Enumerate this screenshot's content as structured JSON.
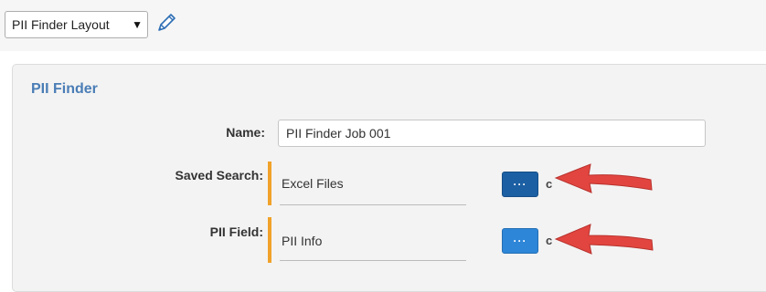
{
  "toolbar": {
    "layout_select": "PII Finder Layout",
    "caret_icon": "▼",
    "edit_icon": "pencil-icon"
  },
  "card": {
    "title": "PII Finder",
    "fields": {
      "name": {
        "label": "Name:",
        "value": "PII Finder Job 001"
      },
      "saved_search": {
        "label": "Saved Search:",
        "value": "Excel Files",
        "button": "···"
      },
      "pii_field": {
        "label": "PII Field:",
        "value": "PII Info",
        "button": "···"
      }
    }
  },
  "colors": {
    "title": "#4a7db6",
    "required_bar": "#f0a22a",
    "button_dark": "#1c5fa3",
    "button_light": "#2e86d8",
    "annotation_arrow": "#e2453f"
  }
}
